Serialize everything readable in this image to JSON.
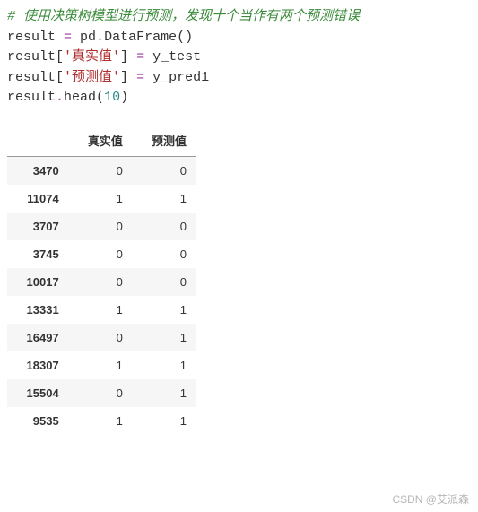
{
  "code": {
    "comment": "# 使用决策树模型进行预测，发现十个当作有两个预测错误",
    "l1_a": "result ",
    "l1_op": "=",
    "l1_b": " pd",
    "l1_c": ".",
    "l1_d": "DataFrame",
    "l1_e": "()",
    "l2_a": "result",
    "l2_b": "[",
    "l2_c": "'真实值'",
    "l2_d": "]",
    "l2_e": " ",
    "l2_op": "=",
    "l2_f": " y_test",
    "l3_a": "result",
    "l3_b": "[",
    "l3_c": "'预测值'",
    "l3_d": "]",
    "l3_e": " ",
    "l3_op": "=",
    "l3_f": " y_pred1",
    "l4_a": "result",
    "l4_b": ".",
    "l4_c": "head",
    "l4_d": "(",
    "l4_e": "10",
    "l4_f": ")"
  },
  "table": {
    "columns": [
      "真实值",
      "预测值"
    ],
    "rows": [
      {
        "idx": "3470",
        "v0": "0",
        "v1": "0"
      },
      {
        "idx": "11074",
        "v0": "1",
        "v1": "1"
      },
      {
        "idx": "3707",
        "v0": "0",
        "v1": "0"
      },
      {
        "idx": "3745",
        "v0": "0",
        "v1": "0"
      },
      {
        "idx": "10017",
        "v0": "0",
        "v1": "0"
      },
      {
        "idx": "13331",
        "v0": "1",
        "v1": "1"
      },
      {
        "idx": "16497",
        "v0": "0",
        "v1": "1"
      },
      {
        "idx": "18307",
        "v0": "1",
        "v1": "1"
      },
      {
        "idx": "15504",
        "v0": "0",
        "v1": "1"
      },
      {
        "idx": "9535",
        "v0": "1",
        "v1": "1"
      }
    ]
  },
  "watermark": "CSDN @艾派森"
}
